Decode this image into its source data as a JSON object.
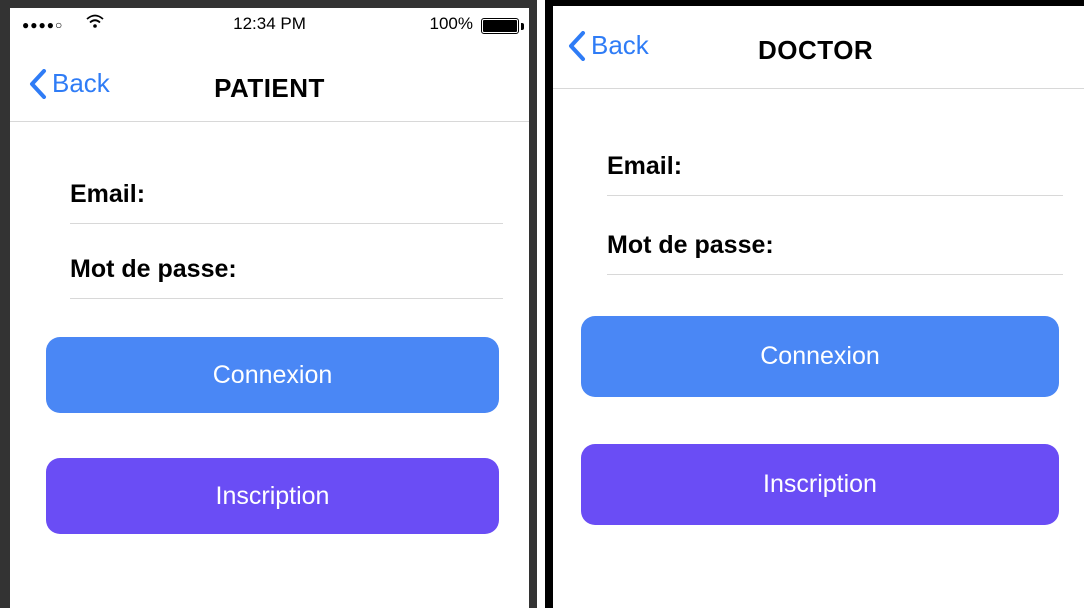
{
  "colors": {
    "accent_blue": "#2f7cf6",
    "connexion_button": "#4a87f5",
    "inscription_button": "#6a4df5"
  },
  "patient": {
    "status_bar": {
      "time": "12:34 PM",
      "battery": "100%",
      "signal_icon": "signal-dots-icon",
      "wifi_icon": "wifi-icon"
    },
    "nav": {
      "back_label": "Back",
      "title": "PATIENT"
    },
    "form": {
      "email_label": "Email:",
      "password_label": "Mot de passe:",
      "login_label": "Connexion",
      "signup_label": "Inscription"
    }
  },
  "doctor": {
    "nav": {
      "back_label": "Back",
      "title": "DOCTOR"
    },
    "form": {
      "email_label": "Email:",
      "password_label": "Mot de passe:",
      "login_label": "Connexion",
      "signup_label": "Inscription"
    }
  }
}
